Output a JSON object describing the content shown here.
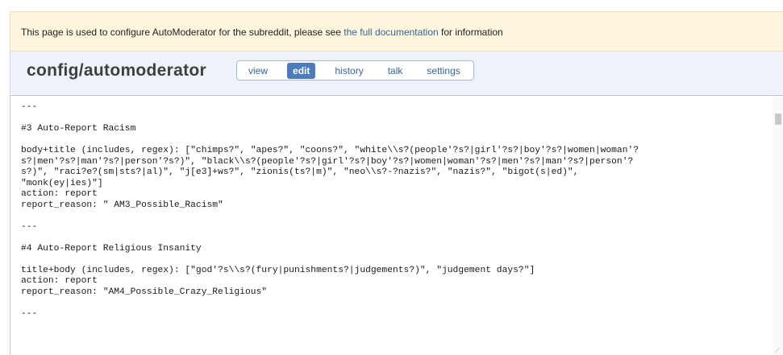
{
  "notice": {
    "prefix": "This page is used to configure AutoModerator for the subreddit, please see ",
    "link": "the full documentation",
    "suffix": " for information"
  },
  "page": {
    "title": "config/automoderator"
  },
  "tabs": [
    {
      "label": "view",
      "active": false
    },
    {
      "label": "edit",
      "active": true
    },
    {
      "label": "history",
      "active": false
    },
    {
      "label": "talk",
      "active": false
    },
    {
      "label": "settings",
      "active": false
    }
  ],
  "editor": {
    "content": "---\n\n#3 Auto-Report Racism\n\nbody+title (includes, regex): [\"chimps?\", \"apes?\", \"coons?\", \"white\\\\s?(people'?s?|girl'?s?|boy'?s?|women|woman'?\ns?|men'?s?|man'?s?|person'?s?)\", \"black\\\\s?(people'?s?|girl'?s?|boy'?s?|women|woman'?s?|men'?s?|man'?s?|person'?\ns?)\", \"raci?e?(sm|sts?|al)\", \"j[e3]+ws?\", \"zionis(ts?|m)\", \"neo\\\\s?-?nazis?\", \"nazis?\", \"bigot(s|ed)\",\n\"monk(ey|ies)\"]\naction: report\nreport_reason: \" AM3_Possible_Racism\"\n\n---\n\n#4 Auto-Report Religious Insanity\n\ntitle+body (includes, regex): [\"god'?s\\\\s?(fury|punishments?|judgements?)\", \"judgement days?\"]\naction: report\nreport_reason: \"AM4_Possible_Crazy_Religious\"\n\n---"
  }
}
